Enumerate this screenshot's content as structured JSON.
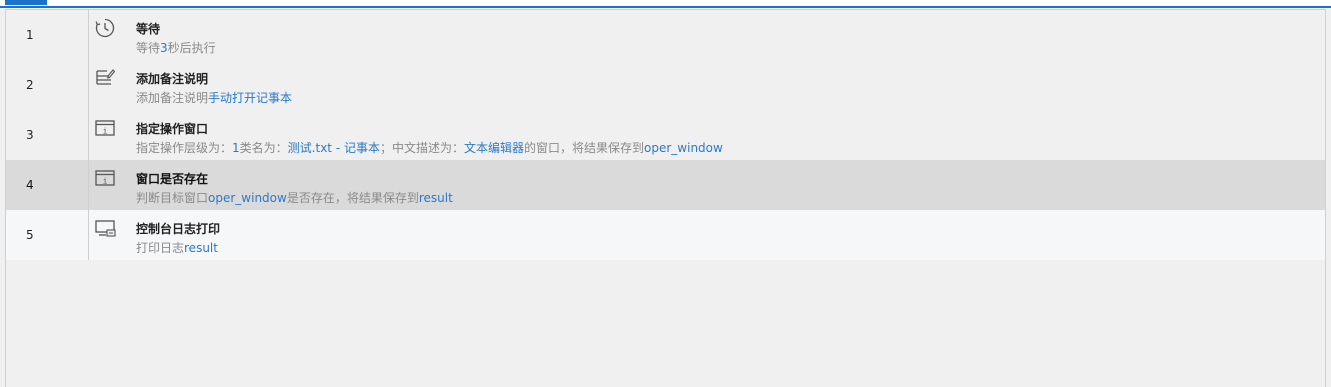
{
  "colors": {
    "accent": "#1a73c9",
    "highlight_text": "#2a79c9",
    "selected_row": "#dadada"
  },
  "rows": [
    {
      "num": "1",
      "icon": "clock-icon",
      "title": "等待",
      "desc": [
        {
          "t": "等待",
          "h": false
        },
        {
          "t": "3",
          "h": true
        },
        {
          "t": "秒后执行",
          "h": false
        }
      ]
    },
    {
      "num": "2",
      "icon": "note-edit-icon",
      "title": "添加备注说明",
      "desc": [
        {
          "t": "添加备注说明",
          "h": false
        },
        {
          "t": "手动打开记事本",
          "h": true
        }
      ]
    },
    {
      "num": "3",
      "icon": "window-icon",
      "title": "指定操作窗口",
      "desc": [
        {
          "t": "指定操作层级为：",
          "h": false
        },
        {
          "t": "1",
          "h": true
        },
        {
          "t": "类名为：",
          "h": false
        },
        {
          "t": "测试.txt - 记事本",
          "h": true
        },
        {
          "t": "；中文描述为：",
          "h": false
        },
        {
          "t": "文本编辑器",
          "h": true
        },
        {
          "t": "的窗口，将结果保存到",
          "h": false
        },
        {
          "t": "oper_window",
          "h": true
        }
      ]
    },
    {
      "num": "4",
      "icon": "window-icon",
      "title": "窗口是否存在",
      "selected": true,
      "desc": [
        {
          "t": "判断目标窗口",
          "h": false
        },
        {
          "t": "oper_window",
          "h": true
        },
        {
          "t": "是否存在，将结果保存到",
          "h": false
        },
        {
          "t": "result",
          "h": true
        }
      ]
    },
    {
      "num": "5",
      "icon": "console-print-icon",
      "title": "控制台日志打印",
      "desc": [
        {
          "t": "打印日志",
          "h": false
        },
        {
          "t": "result",
          "h": true
        }
      ]
    }
  ]
}
